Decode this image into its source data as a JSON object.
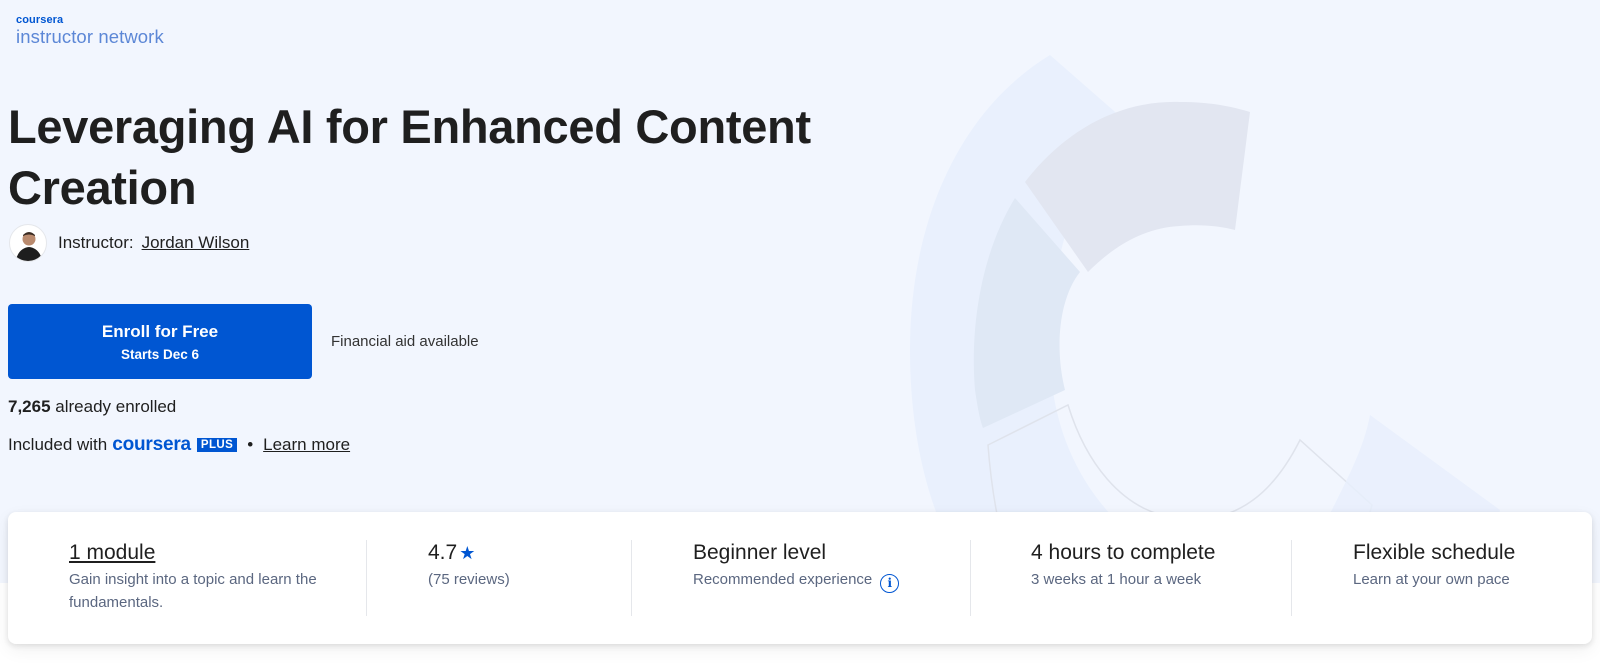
{
  "brand": {
    "logo_name": "coursera",
    "logo_sub": "instructor network",
    "accent_color": "#0056d2"
  },
  "course": {
    "title": "Leveraging AI for Enhanced Content Creation",
    "instructor_label": "Instructor:",
    "instructor_name": "Jordan Wilson"
  },
  "enroll": {
    "button_label": "Enroll for Free",
    "button_sub": "Starts Dec 6",
    "financial_aid": "Financial aid available",
    "enrolled_count": "7,265",
    "enrolled_suffix": "already enrolled",
    "included_prefix": "Included with",
    "plus_brand": "coursera",
    "plus_badge": "PLUS",
    "separator": "•",
    "learn_more": "Learn more"
  },
  "stats": [
    {
      "title": "1 module",
      "sub": "Gain insight into a topic and learn the fundamentals."
    },
    {
      "title": "4.7",
      "icon": "star-icon",
      "sub": "(75 reviews)"
    },
    {
      "title": "Beginner level",
      "sub": "Recommended experience",
      "icon": "info-icon"
    },
    {
      "title": "4 hours to complete",
      "sub": "3 weeks at 1 hour a week"
    },
    {
      "title": "Flexible schedule",
      "sub": "Learn at your own pace"
    }
  ],
  "icons": {
    "star": "★",
    "info": "i"
  }
}
